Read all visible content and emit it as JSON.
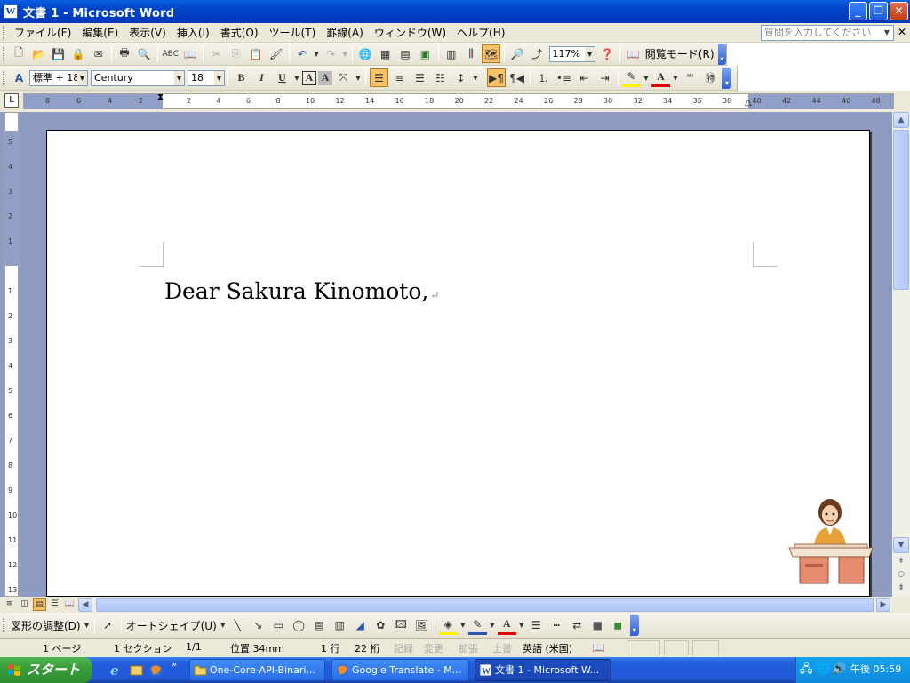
{
  "window": {
    "title": "文書 1 - Microsoft Word",
    "icon": "word-doc-icon"
  },
  "menubar": {
    "items": [
      "ファイル(F)",
      "編集(E)",
      "表示(V)",
      "挿入(I)",
      "書式(O)",
      "ツール(T)",
      "罫線(A)",
      "ウィンドウ(W)",
      "ヘルプ(H)"
    ],
    "help_placeholder": "質問を入力してください"
  },
  "standard_toolbar": {
    "zoom": "117%",
    "reading_mode": "閲覧モード(R)"
  },
  "formatting_toolbar": {
    "style": "標準 + 18",
    "font": "Century",
    "size": "18"
  },
  "ruler": {
    "h_ticks": [
      "8",
      "6",
      "4",
      "2",
      "2",
      "4",
      "6",
      "8",
      "10",
      "12",
      "14",
      "16",
      "18",
      "20",
      "22",
      "24",
      "26",
      "28",
      "30",
      "32",
      "34",
      "36",
      "38",
      "40",
      "42",
      "44",
      "46",
      "48"
    ],
    "v_ticks": [
      "5",
      "4",
      "3",
      "2",
      "1",
      "1",
      "2",
      "3",
      "4",
      "5",
      "6",
      "7",
      "8",
      "9",
      "10",
      "11",
      "12",
      "13"
    ]
  },
  "document": {
    "text": "Dear Sakura Kinomoto,",
    "paragraph_mark": "↵"
  },
  "drawing_toolbar": {
    "draw_menu": "図形の調整(D)",
    "autoshape": "オートシェイプ(U)"
  },
  "statusbar": {
    "page": "1 ページ",
    "section": "1 セクション",
    "page_of": "1/1",
    "position": "位置 34mm",
    "line": "1 行",
    "column": "22 桁",
    "rec": "記録",
    "trk": "変更",
    "ext": "拡張",
    "ovr": "上書",
    "language": "英語 (米国)"
  },
  "taskbar": {
    "start": "スタート",
    "tasks": [
      {
        "label": "One-Core-API-Binari...",
        "icon": "folder-icon"
      },
      {
        "label": "Google Translate - M...",
        "icon": "firefox-icon"
      },
      {
        "label": "文書 1 - Microsoft W...",
        "icon": "word-icon"
      }
    ],
    "clock": "午後 05:59"
  },
  "colors": {
    "titlebar": "#0043c8",
    "taskbar": "#245edc",
    "start": "#3a9e3a",
    "active_button": "#f6c36b",
    "workspace": "#8e9bc3"
  }
}
